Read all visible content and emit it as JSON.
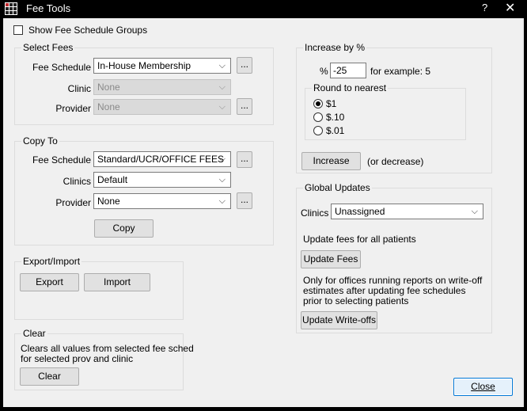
{
  "window": {
    "title": "Fee Tools",
    "help_label": "?",
    "close_glyph": "✕"
  },
  "show_groups": {
    "label": "Show Fee Schedule Groups",
    "checked": false
  },
  "select_fees": {
    "title": "Select Fees",
    "fee_schedule_label": "Fee Schedule",
    "fee_schedule_value": "In-House Membership",
    "clinic_label": "Clinic",
    "clinic_value": "None",
    "provider_label": "Provider",
    "provider_value": "None",
    "ellipsis": "..."
  },
  "copy_to": {
    "title": "Copy To",
    "fee_schedule_label": "Fee Schedule",
    "fee_schedule_value": "Standard/UCR/OFFICE FEES",
    "clinics_label": "Clinics",
    "clinics_value": "Default",
    "provider_label": "Provider",
    "provider_value": "None",
    "copy_button": "Copy",
    "ellipsis": "..."
  },
  "export_import": {
    "title": "Export/Import",
    "export_button": "Export",
    "import_button": "Import"
  },
  "clear": {
    "title": "Clear",
    "desc_line1": "Clears all values from selected fee sched",
    "desc_line2": "for selected prov and clinic",
    "clear_button": "Clear"
  },
  "increase": {
    "title": "Increase by %",
    "percent_label": "%",
    "percent_value": "-25",
    "example": "for example: 5",
    "round_title": "Round to nearest",
    "round_options": [
      "$1",
      "$.10",
      "$.01"
    ],
    "round_selected": "$1",
    "increase_button": "Increase",
    "or_decrease": "(or decrease)"
  },
  "global_updates": {
    "title": "Global Updates",
    "clinics_label": "Clinics",
    "clinics_value": "Unassigned",
    "update_fees_desc": "Update fees for all patients",
    "update_fees_button": "Update Fees",
    "writeoff_desc_1": "Only for offices running reports on write-off",
    "writeoff_desc_2": "estimates after updating fee schedules",
    "writeoff_desc_3": "prior to selecting patients",
    "update_writeoffs_button": "Update Write-offs"
  },
  "close_button": "Close",
  "colors": {
    "titlebar": "#000000",
    "client": "#f0f0f0",
    "focus_border": "#0078d7"
  },
  "icons": [
    "app-grid-icon",
    "help-icon",
    "close-icon",
    "chevron-down-icon"
  ]
}
